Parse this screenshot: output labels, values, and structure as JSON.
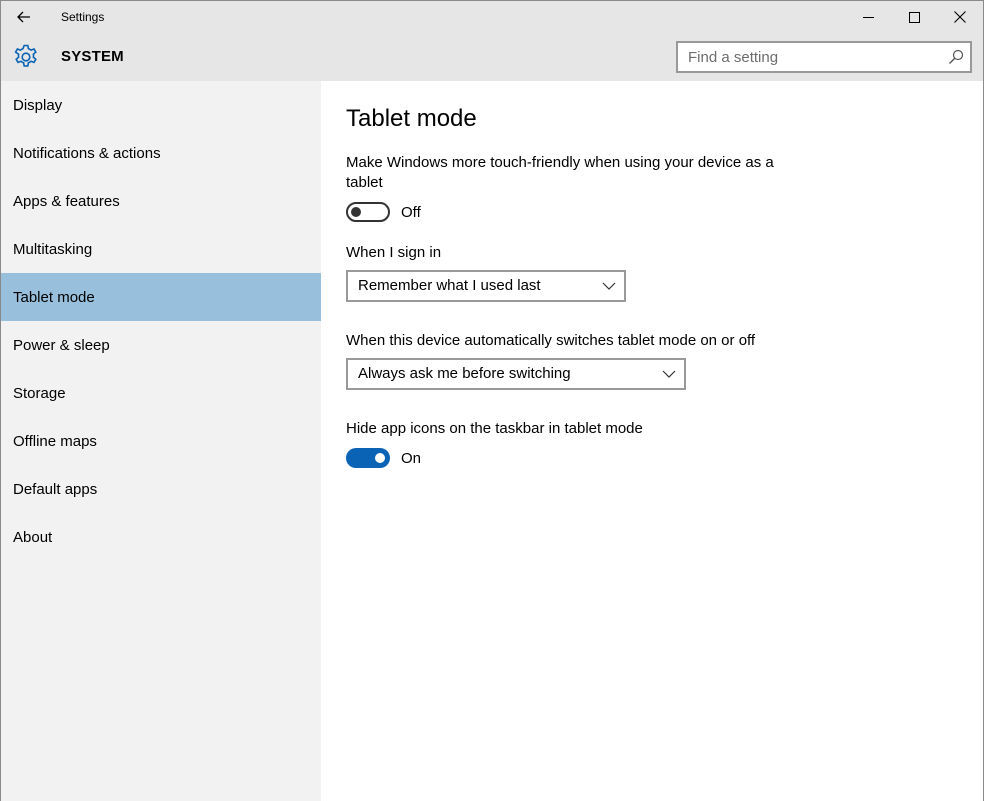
{
  "window": {
    "title": "Settings"
  },
  "header": {
    "section_title": "SYSTEM",
    "search_placeholder": "Find a setting"
  },
  "sidebar": {
    "items": [
      {
        "label": "Display"
      },
      {
        "label": "Notifications & actions"
      },
      {
        "label": "Apps & features"
      },
      {
        "label": "Multitasking"
      },
      {
        "label": "Tablet mode"
      },
      {
        "label": "Power & sleep"
      },
      {
        "label": "Storage"
      },
      {
        "label": "Offline maps"
      },
      {
        "label": "Default apps"
      },
      {
        "label": "About"
      }
    ],
    "active_index": 4
  },
  "main": {
    "title": "Tablet mode",
    "touch_friendly": {
      "description_line1": "Make Windows more touch-friendly when using your device as a",
      "description_line2": "tablet",
      "state": "Off"
    },
    "sign_in": {
      "label": "When I sign in",
      "selected": "Remember what I used last"
    },
    "auto_switch": {
      "label": "When this device automatically switches tablet mode on or off",
      "selected": "Always ask me before switching"
    },
    "hide_icons": {
      "label": "Hide app icons on the taskbar in tablet mode",
      "state": "On"
    }
  },
  "colors": {
    "accent": "#0a63b4",
    "active_nav": "#98bfdc",
    "chrome": "#e6e6e6",
    "sidebar": "#f2f2f2"
  }
}
